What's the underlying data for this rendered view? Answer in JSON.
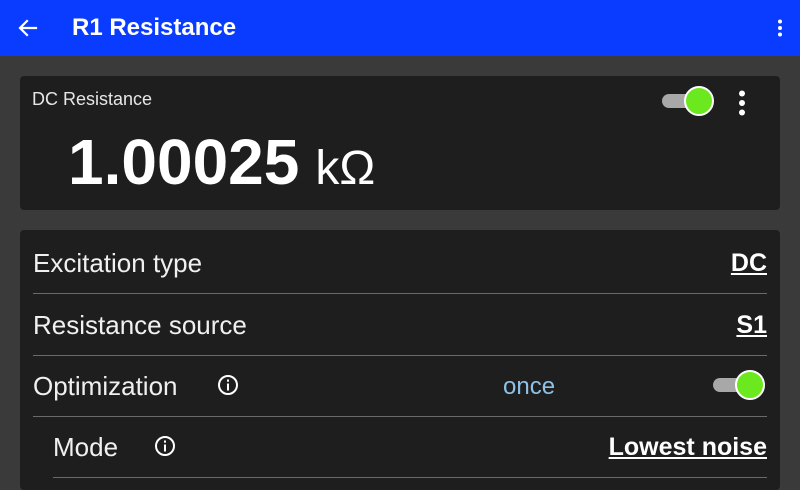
{
  "appbar": {
    "title": "R1 Resistance",
    "back_icon": "arrow-left-icon",
    "menu_icon": "more-vertical-icon",
    "color": "#0a3cff"
  },
  "reading": {
    "label": "DC Resistance",
    "value": "1.00025",
    "unit": "kΩ",
    "enabled": true,
    "toggle_color": "#6be81e",
    "menu_icon": "more-vertical-icon"
  },
  "settings": {
    "rows": [
      {
        "label": "Excitation type",
        "value": "DC"
      },
      {
        "label": "Resistance source",
        "value": "S1"
      },
      {
        "label": "Optimization",
        "status": "once",
        "enabled": true,
        "info_icon": "info-icon"
      },
      {
        "label": "Mode",
        "value": "Lowest noise",
        "info_icon": "info-icon"
      }
    ]
  }
}
